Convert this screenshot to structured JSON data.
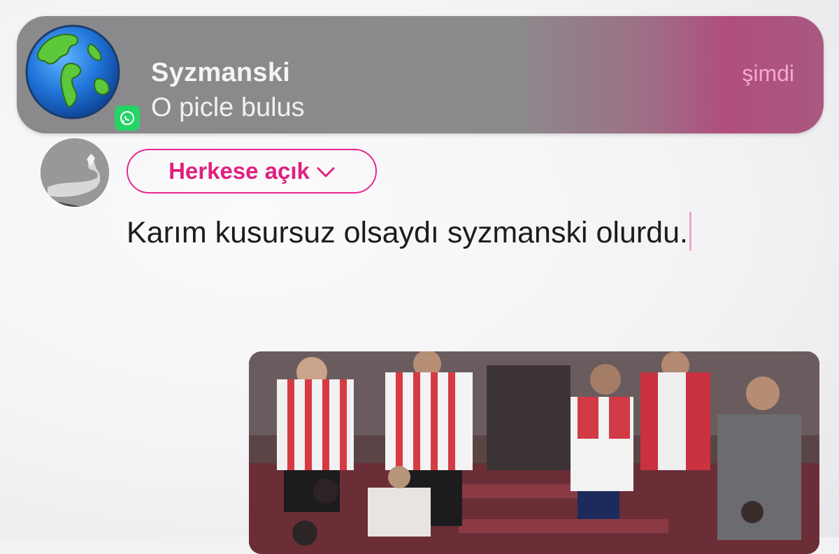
{
  "notification": {
    "sender": "Syzmanski",
    "message": "O picle bulus",
    "time": "şimdi",
    "app_icon": "whatsapp-icon",
    "avatar_icon": "globe-icon"
  },
  "composer": {
    "audience_label": "Herkese açık",
    "text": "Karım kusursuz olsaydı syzmanski olurdu.",
    "accent_color": "#e9258e"
  },
  "media": {
    "type": "video",
    "description_icon": "crowd-photo"
  }
}
